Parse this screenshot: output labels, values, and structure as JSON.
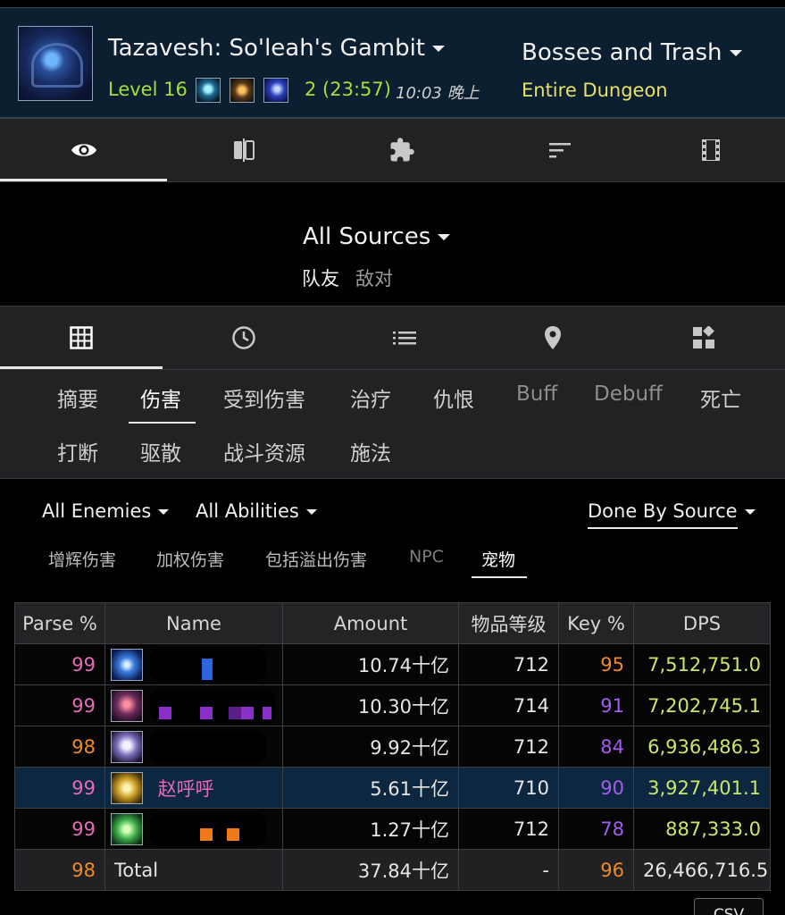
{
  "header": {
    "dungeon_name": "Tazavesh: So'leah's Gambit",
    "level": "Level 16",
    "key_result": "2 (23:57)",
    "time": "10:03 晚上",
    "fight_filter": "Bosses and Trash",
    "fight_scope": "Entire Dungeon",
    "affix_icons": [
      "affix-icon",
      "affix-icon",
      "affix-icon"
    ]
  },
  "top_tabs": [
    {
      "icon": "eye-icon",
      "active": true
    },
    {
      "icon": "compare-icon",
      "active": false
    },
    {
      "icon": "puzzle-icon",
      "active": false
    },
    {
      "icon": "sort-icon",
      "active": false
    },
    {
      "icon": "film-icon",
      "active": false
    }
  ],
  "sources": {
    "title": "All Sources",
    "friendly": "队友",
    "hostile": "敌对"
  },
  "view_tabs": [
    {
      "icon": "grid-icon",
      "active": true
    },
    {
      "icon": "clock-icon",
      "active": false
    },
    {
      "icon": "list-icon",
      "active": false
    },
    {
      "icon": "location-pin-icon",
      "active": false
    },
    {
      "icon": "widgets-icon",
      "active": false
    }
  ],
  "categories": {
    "row1": [
      "摘要",
      "伤害",
      "受到伤害",
      "治疗",
      "仇恨",
      "Buff",
      "Debuff",
      "死亡"
    ],
    "row2": [
      "打断",
      "驱散",
      "战斗资源",
      "施法"
    ],
    "active": "伤害"
  },
  "filters": {
    "enemies": "All Enemies",
    "abilities": "All Abilities",
    "done_by": "Done By Source"
  },
  "sub_filters": [
    "增辉伤害",
    "加权伤害",
    "包括溢出伤害",
    "NPC",
    "宠物"
  ],
  "table": {
    "headers": [
      "Parse %",
      "Name",
      "Amount",
      "物品等级",
      "Key %",
      "DPS"
    ],
    "rows": [
      {
        "parse": "99",
        "name": "",
        "amount": "10.74十亿",
        "ilvl": "712",
        "key": "95",
        "dps": "7,512,751.0"
      },
      {
        "parse": "99",
        "name": "",
        "amount": "10.30十亿",
        "ilvl": "714",
        "key": "91",
        "dps": "7,202,745.1"
      },
      {
        "parse": "98",
        "name": "",
        "amount": "9.92十亿",
        "ilvl": "712",
        "key": "84",
        "dps": "6,936,486.3"
      },
      {
        "parse": "99",
        "name": "赵呼呼",
        "amount": "5.61十亿",
        "ilvl": "710",
        "key": "90",
        "dps": "3,927,401.1"
      },
      {
        "parse": "99",
        "name": "",
        "amount": "1.27十亿",
        "ilvl": "712",
        "key": "78",
        "dps": "887,333.0"
      }
    ],
    "total": {
      "parse": "98",
      "name": "Total",
      "amount": "37.84十亿",
      "ilvl": "-",
      "key": "96",
      "dps": "26,466,716.5"
    }
  },
  "colors": {
    "header_bg": "#0c1f30",
    "level_green": "#a3df3d",
    "scope_yellow": "#e9e06a",
    "parse_pink": "#e86ab8",
    "parse_orange": "#f08a25",
    "key_purple": "#a65bf0",
    "dps_green": "#c9e86a"
  },
  "csv_label": "CSV"
}
